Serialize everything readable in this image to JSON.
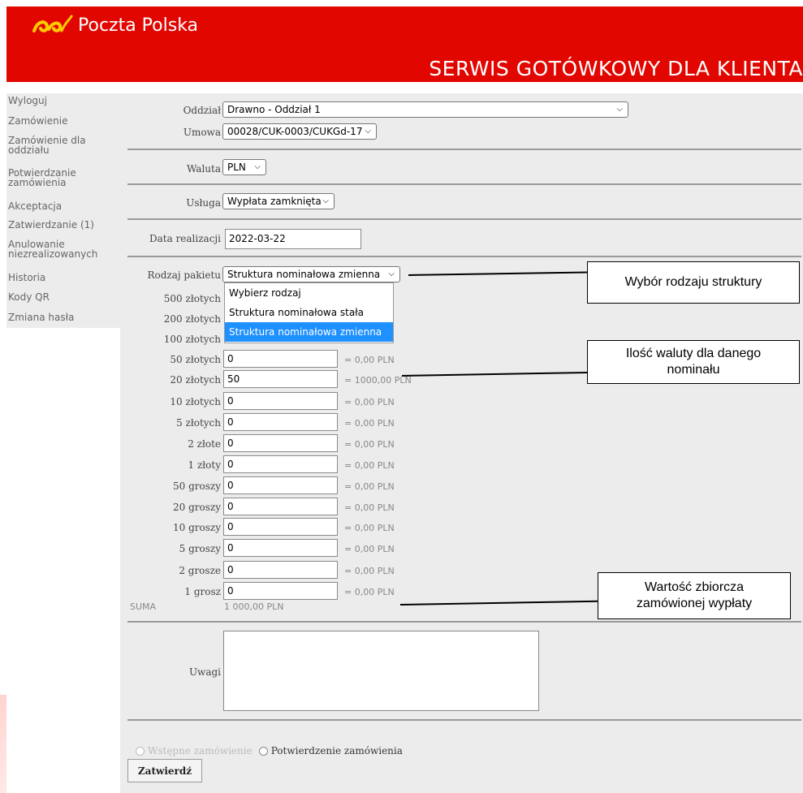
{
  "app": {
    "brand": "Poczta Polska",
    "service_title": "SERWIS GOTÓWKOWY DLA KLIENTA"
  },
  "sidebar": {
    "items": [
      {
        "label": "Wyloguj"
      },
      {
        "label": "Zamówienie"
      },
      {
        "label": "Zamówienie dla oddziału"
      },
      {
        "label": "Potwierdzanie zamówienia"
      },
      {
        "label": "Akceptacja"
      },
      {
        "label": "Zatwierdzanie (1)"
      },
      {
        "label": "Anulowanie niezrealizowanych"
      },
      {
        "label": "Historia"
      },
      {
        "label": "Kody QR"
      },
      {
        "label": "Zmiana hasła"
      }
    ]
  },
  "form": {
    "oddzial": {
      "label": "Oddział",
      "value": "Drawno - Oddział 1"
    },
    "umowa": {
      "label": "Umowa",
      "value": "00028/CUK-0003/CUKGd-17"
    },
    "waluta": {
      "label": "Waluta",
      "value": "PLN"
    },
    "usluga": {
      "label": "Usługa",
      "value": "Wypłata zamknięta"
    },
    "data": {
      "label": "Data realizacji",
      "value": "2022-03-22"
    },
    "rodzaj": {
      "label": "Rodzaj pakietu",
      "value": "Struktura nominałowa zmienna",
      "options": [
        "Wybierz rodzaj",
        "Struktura nominałowa stała",
        "Struktura nominałowa zmienna"
      ]
    },
    "denominations": [
      {
        "label": "500 złotych",
        "value": "",
        "sum": ""
      },
      {
        "label": "200 złotych",
        "value": "",
        "sum": ""
      },
      {
        "label": "100 złotych",
        "value": "",
        "sum": ""
      },
      {
        "label": "50 złotych",
        "value": "0",
        "sum": "= 0,00 PLN"
      },
      {
        "label": "20 złotych",
        "value": "50",
        "sum": "= 1000,00 PLN"
      },
      {
        "label": "10 złotych",
        "value": "0",
        "sum": "= 0,00 PLN"
      },
      {
        "label": "5 złotych",
        "value": "0",
        "sum": "= 0,00 PLN"
      },
      {
        "label": "2 złote",
        "value": "0",
        "sum": "= 0,00 PLN"
      },
      {
        "label": "1 złoty",
        "value": "0",
        "sum": "= 0,00 PLN"
      },
      {
        "label": "50 groszy",
        "value": "0",
        "sum": "= 0,00 PLN"
      },
      {
        "label": "20 groszy",
        "value": "0",
        "sum": "= 0,00 PLN"
      },
      {
        "label": "10 groszy",
        "value": "0",
        "sum": "= 0,00 PLN"
      },
      {
        "label": "5 groszy",
        "value": "0",
        "sum": "= 0,00 PLN"
      },
      {
        "label": "2 grosze",
        "value": "0",
        "sum": "= 0,00 PLN"
      },
      {
        "label": "1 grosz",
        "value": "0",
        "sum": "= 0,00 PLN"
      }
    ],
    "suma": {
      "label": "SUMA",
      "value": "1 000,00 PLN"
    },
    "uwagi": {
      "label": "Uwagi",
      "value": ""
    },
    "radio_wstepne": "Wstępne zamówienie",
    "radio_potwierdzenie": "Potwierdzenie zamówienia",
    "submit": "Zatwierdź"
  },
  "callouts": {
    "struktura": "Wybór rodzaju struktury",
    "ilosc": "Ilość waluty dla danego nominału",
    "wartosc": "Wartość zbiorcza zamówionej wypłaty"
  },
  "colors": {
    "brand_red": "#e10600",
    "highlight": "#1e90ff",
    "panel": "#ececec"
  }
}
